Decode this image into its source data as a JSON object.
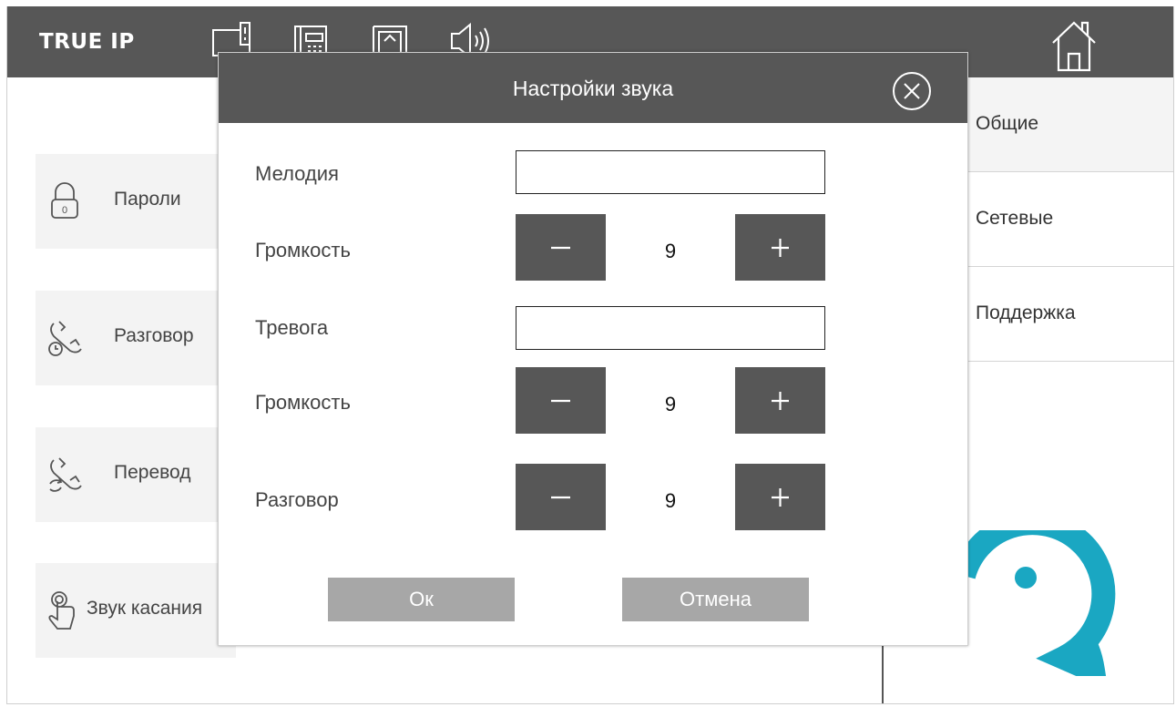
{
  "app": {
    "brand": "TRUE IP"
  },
  "topbar": {
    "icons": [
      "intercom-panel-icon",
      "keypad-icon",
      "door-icon",
      "speaker-icon"
    ],
    "home_icon": "home-icon"
  },
  "left_tiles": [
    {
      "label": "Пароли",
      "icon": "padlock-icon"
    },
    {
      "label": "Разговор",
      "icon": "conversation-icon"
    },
    {
      "label": "Перевод",
      "icon": "transfer-icon"
    },
    {
      "label": "Звук касания",
      "icon": "touch-icon"
    }
  ],
  "right_nav": [
    {
      "label": "Общие",
      "active": true
    },
    {
      "label": "Сетевые",
      "active": false
    },
    {
      "label": "Поддержка",
      "active": false
    }
  ],
  "dialog": {
    "title": "Настройки звука",
    "melody_label": "Мелодия",
    "melody_value": "",
    "volume1_label": "Громкость",
    "volume1_value": "9",
    "alarm_label": "Тревога",
    "alarm_value": "",
    "volume2_label": "Громкость",
    "volume2_value": "9",
    "talk_label": "Разговор",
    "talk_value": "9",
    "minus_icon": "minus-icon",
    "plus_icon": "plus-icon",
    "ok_label": "Ок",
    "cancel_label": "Отмена"
  },
  "colors": {
    "header": "#575757",
    "button_dark": "#575757",
    "button_gray": "#a7a7a7",
    "tile_bg": "#f3f3f3",
    "logo_teal": "#1aa7c2"
  }
}
